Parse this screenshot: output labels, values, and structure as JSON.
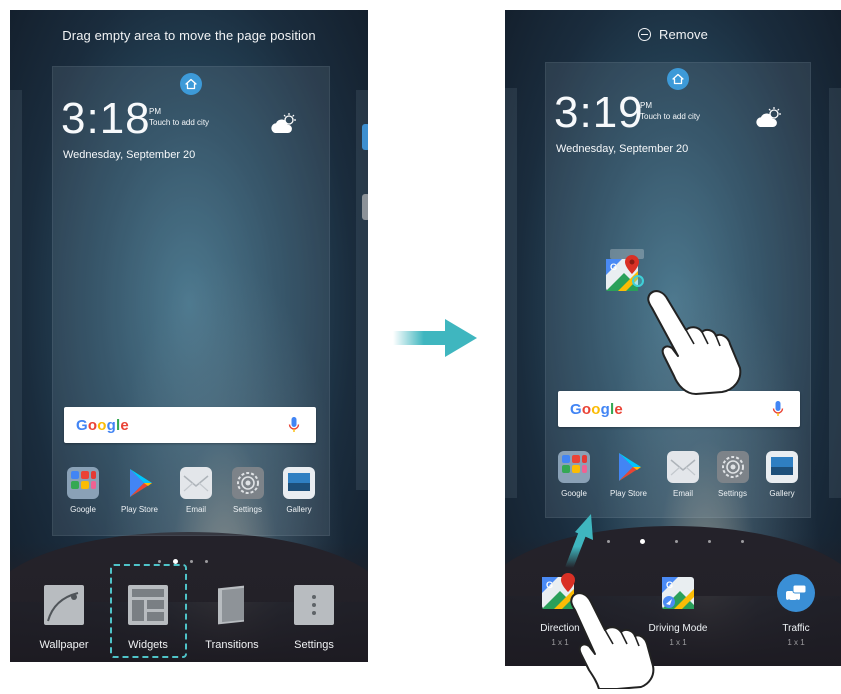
{
  "left_screen": {
    "hint": "Drag empty area to move the page position",
    "clock": {
      "time": "3:18",
      "ampm": "PM",
      "city": "Touch to add city",
      "date": "Wednesday, September 20"
    },
    "search": {
      "logo": "Google"
    },
    "dock": [
      {
        "label": "Google",
        "icon": "folder-icon"
      },
      {
        "label": "Play Store",
        "icon": "play-store-icon"
      },
      {
        "label": "Email",
        "icon": "email-icon"
      },
      {
        "label": "Settings",
        "icon": "settings-gear-icon"
      },
      {
        "label": "Gallery",
        "icon": "gallery-icon"
      }
    ],
    "toolbar": [
      {
        "label": "Wallpaper",
        "icon": "wallpaper-icon"
      },
      {
        "label": "Widgets",
        "icon": "widgets-icon"
      },
      {
        "label": "Transitions",
        "icon": "transitions-icon"
      },
      {
        "label": "Settings",
        "icon": "settings-icon"
      }
    ]
  },
  "right_screen": {
    "remove_label": "Remove",
    "clock": {
      "time": "3:19",
      "ampm": "PM",
      "city": "Touch to add city",
      "date": "Wednesday, September 20"
    },
    "search": {
      "logo": "Google"
    },
    "dock": [
      {
        "label": "Google",
        "icon": "folder-icon"
      },
      {
        "label": "Play Store",
        "icon": "play-store-icon"
      },
      {
        "label": "Email",
        "icon": "email-icon"
      },
      {
        "label": "Settings",
        "icon": "settings-gear-icon"
      },
      {
        "label": "Gallery",
        "icon": "gallery-icon"
      }
    ],
    "widgets": [
      {
        "label": "Direction",
        "size": "1 x 1",
        "icon": "maps-directions-icon"
      },
      {
        "label": "Driving Mode",
        "size": "1 x 1",
        "icon": "maps-driving-icon"
      },
      {
        "label": "Traffic",
        "size": "1 x 1",
        "icon": "traffic-icon"
      }
    ]
  },
  "colors": {
    "accent": "#3fb6bf",
    "home_dot": "#3d9ad8",
    "highlight": "#4fc3c8"
  }
}
